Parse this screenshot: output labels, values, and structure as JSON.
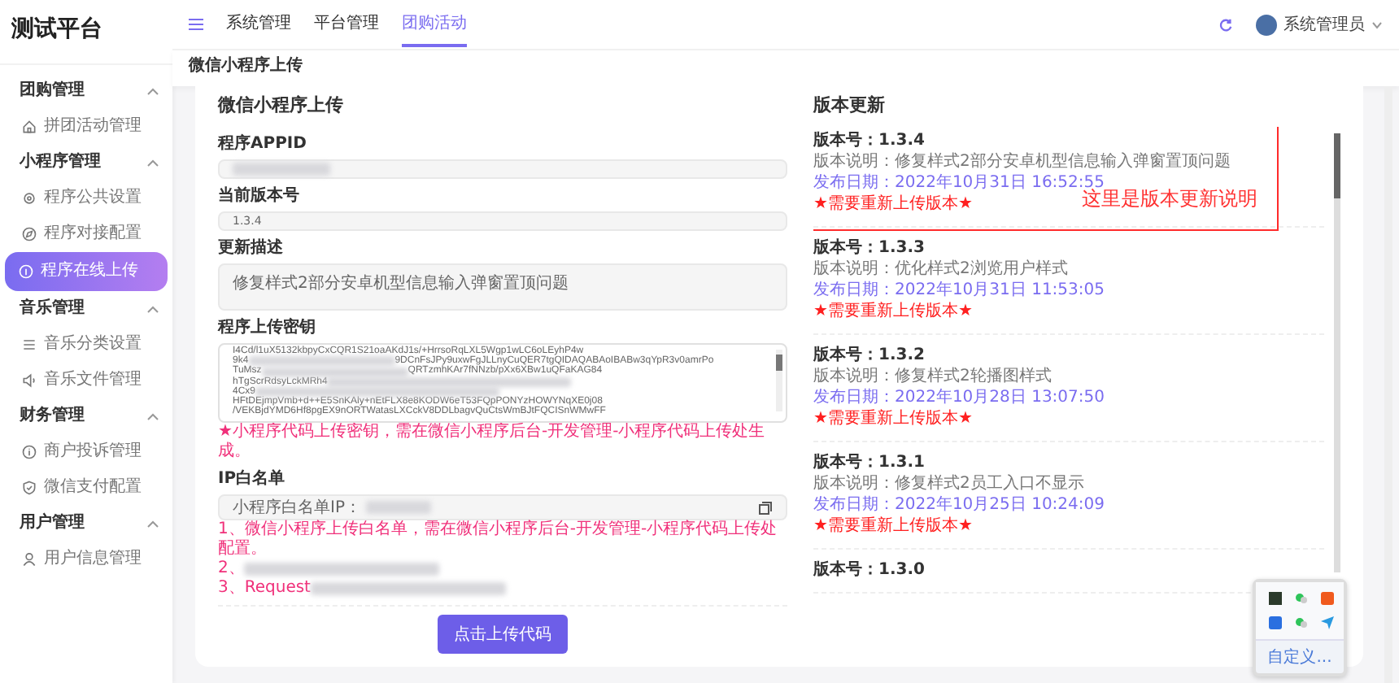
{
  "sidebar": {
    "logo": "测试平台",
    "groups": [
      {
        "label": "团购管理",
        "expanded": true,
        "items": [
          {
            "label": "拼团活动管理",
            "selected": false
          }
        ]
      },
      {
        "label": "小程序管理",
        "expanded": true,
        "items": [
          {
            "label": "程序公共设置",
            "selected": false
          },
          {
            "label": "程序对接配置",
            "selected": false
          },
          {
            "label": "程序在线上传",
            "selected": true
          }
        ]
      },
      {
        "label": "音乐管理",
        "expanded": true,
        "items": [
          {
            "label": "音乐分类设置",
            "selected": false
          },
          {
            "label": "音乐文件管理",
            "selected": false
          }
        ]
      },
      {
        "label": "财务管理",
        "expanded": true,
        "items": [
          {
            "label": "商户投诉管理",
            "selected": false
          },
          {
            "label": "微信支付配置",
            "selected": false
          }
        ]
      },
      {
        "label": "用户管理",
        "expanded": true,
        "items": [
          {
            "label": "用户信息管理",
            "selected": false
          }
        ]
      }
    ]
  },
  "header": {
    "nav": [
      {
        "label": "系统管理",
        "selected": false
      },
      {
        "label": "平台管理",
        "selected": false
      },
      {
        "label": "团购活动",
        "selected": true
      }
    ],
    "user": "系统管理员"
  },
  "page_title": "微信小程序上传",
  "form": {
    "title": "微信小程序上传",
    "appid": {
      "label": "程序APPID"
    },
    "version": {
      "label": "当前版本号",
      "value": "1.3.4"
    },
    "description": {
      "label": "更新描述",
      "value": "修复样式2部分安卓机型信息输入弹窗置顶问题"
    },
    "key": {
      "label": "程序上传密钥",
      "lines": [
        {
          "text": "I4Cd/l1uX5132kbpyCxCQR1S21oaAKdJ1s/+HrrsoRqLXL5Wgp1wLC6oLEyhP4w",
          "redacted": false
        },
        {
          "text": "9k4",
          "redacted": true,
          "tail": "9DCnFsJPy9uxwFgJLLnyCuQER7tgQIDAQABAoIBABw3qYpR3v0amrPo"
        },
        {
          "text": "TuMsz",
          "redacted": true,
          "tail": "QRTzmhKAr7fNNzb/pXx6XBw1uQFaKAG84"
        },
        {
          "text": "hTgScrRdsyLckMRh4",
          "redacted": true
        },
        {
          "text": "4Cx9",
          "redacted": true
        },
        {
          "text": "HFtDEjmpVmb+d++E5SnKAly+nEtFLX8e8KODW6eT53FQpPONYzHOWYNqXE0j08",
          "redacted": false
        },
        {
          "text": "/VEKBjdYMD6Hf8pgEX9nORTWatasLXCckV8DDLbagvQuCtsWmBJtFQCISnWMwFF",
          "redacted": false
        }
      ],
      "note": "★小程序代码上传密钥，需在微信小程序后台-开发管理-小程序代码上传处生成。"
    },
    "ip": {
      "label": "IP白名单",
      "value": "小程序白名单IP：",
      "notes": [
        "1、微信小程序上传白名单，需在微信小程序后台-开发管理-小程序代码上传处配置。",
        "2、",
        "3、Request"
      ]
    },
    "submit": "点击上传代码"
  },
  "versions": {
    "title": "版本更新",
    "annotation": "这里是版本更新说明",
    "entries": [
      {
        "version": "版本号：1.3.4",
        "description": "版本说明：修复样式2部分安卓机型信息输入弹窗置顶问题",
        "date": "发布日期：2022年10月31日 16:52:55",
        "notice": "★需要重新上传版本★"
      },
      {
        "version": "版本号：1.3.3",
        "description": "版本说明：优化样式2浏览用户样式",
        "date": "发布日期：2022年10月31日 11:53:05",
        "notice": "★需要重新上传版本★"
      },
      {
        "version": "版本号：1.3.2",
        "description": "版本说明：修复样式2轮播图样式",
        "date": "发布日期：2022年10月28日 13:07:50",
        "notice": "★需要重新上传版本★"
      },
      {
        "version": "版本号：1.3.1",
        "description": "版本说明：修复样式2员工入口不显示",
        "date": "发布日期：2022年10月25日 10:24:09",
        "notice": "★需要重新上传版本★"
      },
      {
        "version": "版本号：1.3.0"
      }
    ]
  },
  "tray": {
    "link": "自定义..."
  }
}
